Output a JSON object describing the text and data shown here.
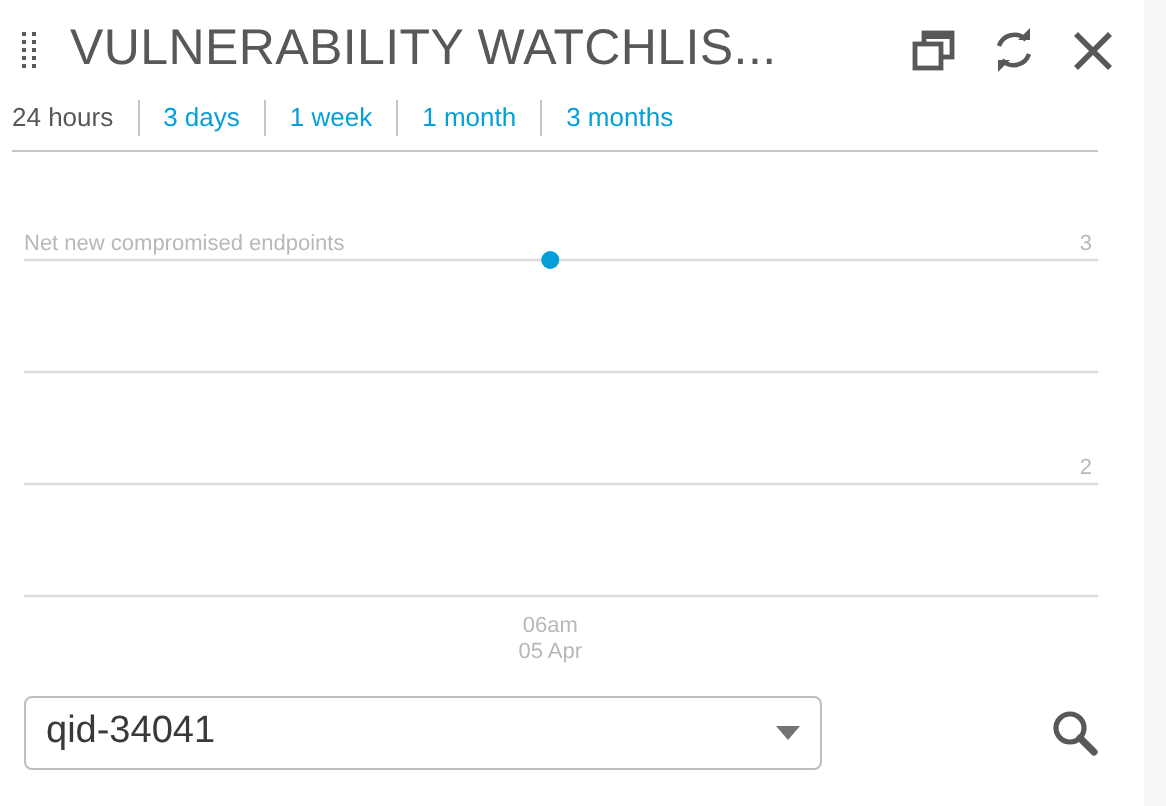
{
  "header": {
    "title": "VULNERABILITY WATCHLIS..."
  },
  "tabs": [
    {
      "label": "24 hours",
      "selected": true
    },
    {
      "label": "3 days",
      "selected": false
    },
    {
      "label": "1 week",
      "selected": false
    },
    {
      "label": "1 month",
      "selected": false
    },
    {
      "label": "3 months",
      "selected": false
    }
  ],
  "chart_data": {
    "type": "line",
    "categories": [
      "06am 05 Apr"
    ],
    "series": [
      {
        "name": "Net new compromised endpoints",
        "color": "#049fd9",
        "marker": "circle",
        "values": [
          3
        ]
      }
    ],
    "ylim": [
      1.5,
      3
    ],
    "yticks": [
      3,
      2
    ]
  },
  "query_select": {
    "value": "qid-34041"
  }
}
